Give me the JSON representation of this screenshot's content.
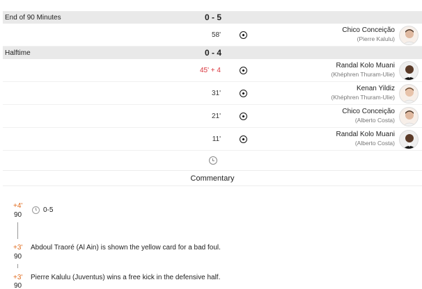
{
  "periods": {
    "end90": {
      "label": "End of 90 Minutes",
      "score": "0 - 5"
    },
    "halftime": {
      "label": "Halftime",
      "score": "0 - 4"
    }
  },
  "events": [
    {
      "minute": "58'",
      "player": "Chico Conceição",
      "assist": "(Pierre Kalulu)",
      "icon": "soccer-ball-icon"
    },
    {
      "minute": "45' + 4",
      "player": "Randal Kolo Muani",
      "assist": "(Khéphren Thuram-Ulie)",
      "icon": "soccer-ball-icon"
    },
    {
      "minute": "31'",
      "player": "Kenan Yildiz",
      "assist": "(Khéphren Thuram-Ulie)",
      "icon": "soccer-ball-icon"
    },
    {
      "minute": "21'",
      "player": "Chico Conceição",
      "assist": "(Alberto Costa)",
      "icon": "soccer-ball-icon"
    },
    {
      "minute": "11'",
      "player": "Randal Kolo Muani",
      "assist": "(Alberto Costa)",
      "icon": "soccer-ball-icon"
    }
  ],
  "commentary": {
    "title": "Commentary",
    "entries": [
      {
        "plus": "+4'",
        "minute": "90",
        "text": "0-5"
      },
      {
        "plus": "+3'",
        "minute": "90",
        "text": "Abdoul Traoré (Al Ain) is shown the yellow card for a bad foul."
      },
      {
        "plus": "+3'",
        "minute": "90",
        "text": "Pierre Kalulu (Juventus) wins a free kick in the defensive half."
      }
    ]
  },
  "colors": {
    "stoppage_minute": "#d9363e",
    "commentary_plus": "#e06a1b",
    "period_bar": "#e9e9e9"
  }
}
